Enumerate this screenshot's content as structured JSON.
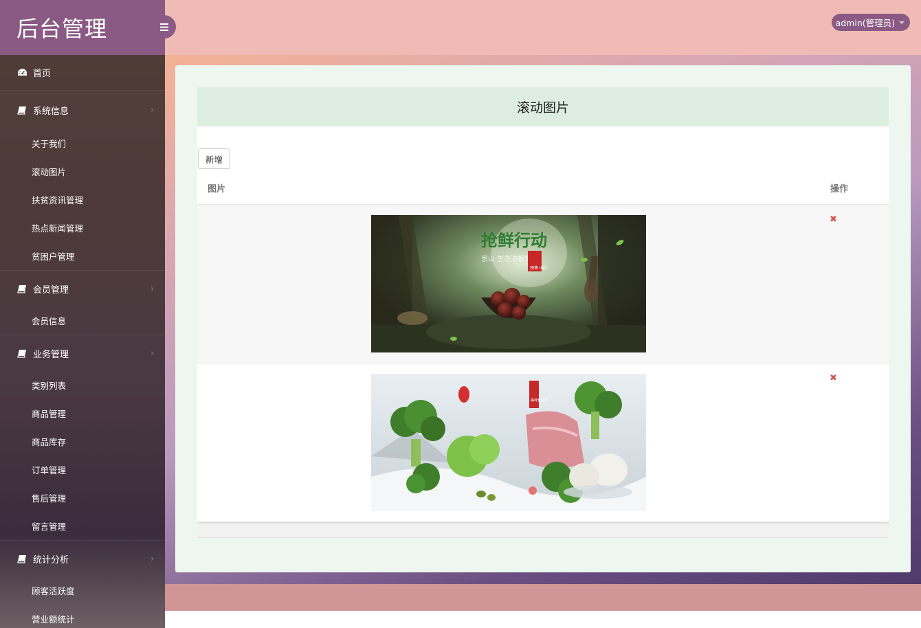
{
  "brand": {
    "title": "后台管理"
  },
  "topbar": {
    "user_label": "admin(管理员)"
  },
  "sidebar": {
    "home": "首页",
    "groups": [
      {
        "label": "系统信息",
        "items": [
          "关于我们",
          "滚动图片",
          "扶贫资讯管理",
          "热点新闻管理",
          "贫困户管理"
        ]
      },
      {
        "label": "会员管理",
        "items": [
          "会员信息"
        ]
      },
      {
        "label": "业务管理",
        "items": [
          "类别列表",
          "商品管理",
          "商品库存",
          "订单管理",
          "售后管理",
          "留言管理"
        ]
      },
      {
        "label": "统计分析",
        "items": [
          "顾客活跃度",
          "营业额统计"
        ]
      }
    ]
  },
  "main": {
    "panel_title": "滚动图片",
    "add_button": "新增",
    "columns": {
      "image": "图片",
      "action": "操作"
    },
    "rows": [
      {
        "image_alt": "抢鲜行动 banner",
        "banner_text": "抢鲜行动",
        "banner_sub": "京山·生态油板栗",
        "banner_tag": "预售 ING",
        "delete_icon": "✖"
      },
      {
        "image_alt": "vegetables banner",
        "banner_tag": "美味食用油",
        "delete_icon": "✖"
      }
    ]
  },
  "colors": {
    "brand": "#8a5a84",
    "topbar": "#f0bbb5",
    "panel_head": "#ddeee1",
    "delete": "#d9534f"
  }
}
